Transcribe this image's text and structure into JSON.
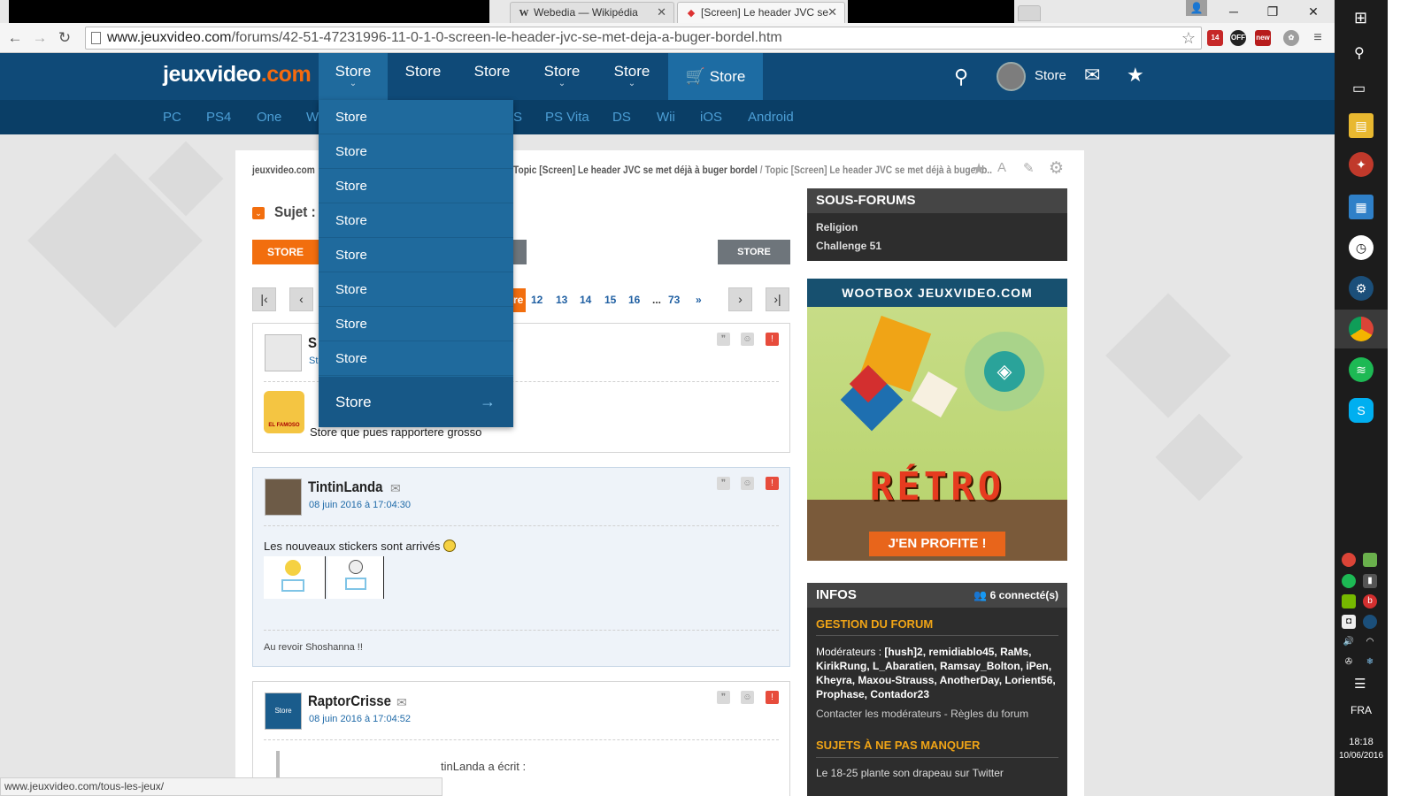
{
  "browser": {
    "tabs": [
      {
        "title": "Webedia — Wikipédia",
        "icon": "W"
      },
      {
        "title": "[Screen] Le header JVC se",
        "icon": "🎮"
      }
    ],
    "url_prefix": "www.jeuxvideo.com",
    "url_path": "/forums/42-51-47231996-11-0-1-0-screen-le-header-jvc-se-met-deja-a-buger-bordel.htm",
    "status_url": "www.jeuxvideo.com/tous-les-jeux/",
    "ext_badges": [
      "14",
      "OFF",
      "new"
    ]
  },
  "site": {
    "logo_main": "jeuxvideo",
    "logo_tld": ".com",
    "nav": [
      "Store",
      "Store",
      "Store",
      "Store",
      "Store"
    ],
    "nav_store": "Store",
    "user_label": "Store",
    "subnav": [
      "PC",
      "PS4",
      "One",
      "W",
      "S",
      "PS Vita",
      "DS",
      "Wii",
      "iOS",
      "Android"
    ]
  },
  "dropdown": {
    "items": [
      "Store",
      "Store",
      "Store",
      "Store",
      "Store",
      "Store",
      "Store",
      "Store"
    ],
    "last": "Store",
    "last_arrow": "→"
  },
  "breadcrumb": {
    "home": "jeuxvideo.com",
    "t1": "Topic [Screen] Le header JVC se met déjà à buger bordel",
    "sep": "/",
    "t2": "Topic [Screen] Le header JVC se met déjà à buger b.."
  },
  "topic": {
    "subject_label": "Sujet :",
    "btn_store_orange": "STORE",
    "btn_store_grey": "STORE"
  },
  "pagination": {
    "current_tail": "re",
    "pages": [
      "12",
      "13",
      "14",
      "15",
      "16"
    ],
    "ellipsis": "...",
    "last": "73",
    "next": "»"
  },
  "posts": [
    {
      "name": "S",
      "date": "St",
      "text": "Store que pues rapportere grosso",
      "sticker": "EL FAMOSO"
    },
    {
      "name": "TintinLanda",
      "date": "08 juin 2016 à 17:04:30",
      "text": "Les nouveaux stickers sont arrivés",
      "signature": "Au revoir Shoshanna !!"
    },
    {
      "name": "RaptorCrisse",
      "date": "08 juin 2016 à 17:04:52",
      "avatar_text": "Store",
      "quote": "tinLanda a écrit :"
    }
  ],
  "sidebar": {
    "subforums_title": "SOUS-FORUMS",
    "subforums": [
      "Religion",
      "Challenge 51"
    ],
    "wootbox_title": "WOOTBOX JEUXVIDEO.COM",
    "wootbox_retro": "RÉTRO",
    "wootbox_cta": "J'EN PROFITE !",
    "infos_title": "INFOS",
    "connected": "6 connecté(s)",
    "gestion_title": "GESTION DU FORUM",
    "moderators_label": "Modérateurs :",
    "moderators": "[hush]2, remidiablo45, RaMs, KirikRung, L_Abaratien, Ramsay_Bolton, iPen, Kheyra, Maxou-Strauss, AnotherDay, Lorient56, Prophase, Contador23",
    "contact": "Contacter les modérateurs - Règles du forum",
    "sujets_title": "SUJETS À NE PAS MANQUER",
    "sujet1": "Le 18-25 plante son drapeau sur Twitter"
  },
  "taskbar": {
    "lang": "FRA",
    "time": "18:18",
    "date": "10/06/2016"
  },
  "colors": {
    "header_blue": "#0f4a78",
    "dropdown_blue": "#1f6a9d",
    "accent_orange": "#f26e0e",
    "link_blue": "#1f6aa8"
  }
}
